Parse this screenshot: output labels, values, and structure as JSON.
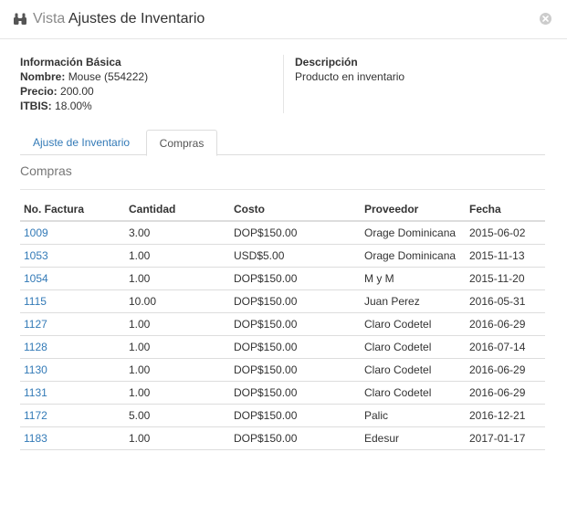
{
  "header": {
    "icon": "binoculars-icon",
    "title_prefix": "Vista",
    "title_main": "Ajustes de Inventario",
    "close_icon": "close-circle-icon"
  },
  "basic_info": {
    "heading": "Información Básica",
    "name_label": "Nombre:",
    "name_value": "Mouse (554222)",
    "price_label": "Precio:",
    "price_value": "200.00",
    "tax_label": "ITBIS:",
    "tax_value": "18.00%"
  },
  "description": {
    "heading": "Descripción",
    "text": "Producto en inventario"
  },
  "tabs": [
    {
      "label": "Ajuste de Inventario",
      "active": false
    },
    {
      "label": "Compras",
      "active": true
    }
  ],
  "section_title": "Compras",
  "table": {
    "headers": [
      "No. Factura",
      "Cantidad",
      "Costo",
      "Proveedor",
      "Fecha"
    ],
    "rows": [
      [
        "1009",
        "3.00",
        "DOP$150.00",
        "Orage Dominicana",
        "2015-06-02"
      ],
      [
        "1053",
        "1.00",
        "USD$5.00",
        "Orage Dominicana",
        "2015-11-13"
      ],
      [
        "1054",
        "1.00",
        "DOP$150.00",
        "M y M",
        "2015-11-20"
      ],
      [
        "1115",
        "10.00",
        "DOP$150.00",
        "Juan Perez",
        "2016-05-31"
      ],
      [
        "1127",
        "1.00",
        "DOP$150.00",
        "Claro Codetel",
        "2016-06-29"
      ],
      [
        "1128",
        "1.00",
        "DOP$150.00",
        "Claro Codetel",
        "2016-07-14"
      ],
      [
        "1130",
        "1.00",
        "DOP$150.00",
        "Claro Codetel",
        "2016-06-29"
      ],
      [
        "1131",
        "1.00",
        "DOP$150.00",
        "Claro Codetel",
        "2016-06-29"
      ],
      [
        "1172",
        "5.00",
        "DOP$150.00",
        "Palic",
        "2016-12-21"
      ],
      [
        "1183",
        "1.00",
        "DOP$150.00",
        "Edesur",
        "2017-01-17"
      ]
    ]
  },
  "colors": {
    "link": "#337ab7",
    "muted": "#777777",
    "border": "#dddddd"
  }
}
